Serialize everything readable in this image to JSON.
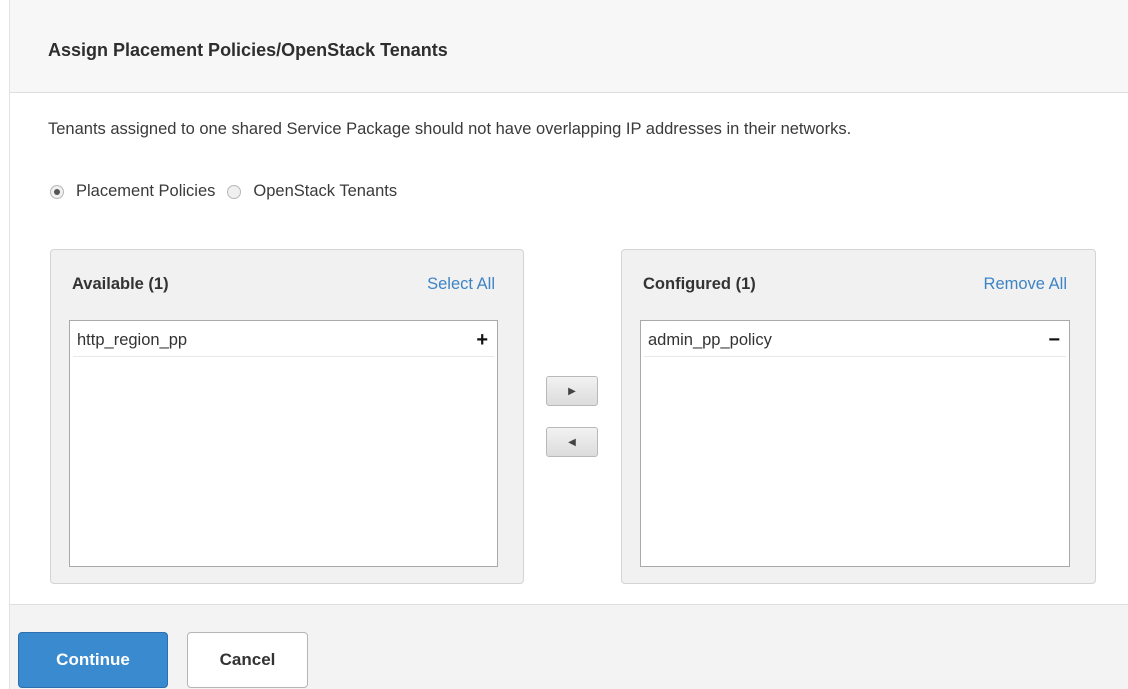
{
  "dialog": {
    "title": "Assign Placement Policies/OpenStack Tenants",
    "notice": "Tenants assigned to one shared Service Package should not have overlapping IP addresses in their networks."
  },
  "mode": {
    "options": [
      {
        "label": "Placement Policies",
        "selected": true
      },
      {
        "label": "OpenStack Tenants",
        "selected": false
      }
    ]
  },
  "available": {
    "title": "Available (1)",
    "action_link": "Select All",
    "items": [
      {
        "label": "http_region_pp",
        "action": "+"
      }
    ]
  },
  "configured": {
    "title": "Configured (1)",
    "action_link": "Remove All",
    "items": [
      {
        "label": "admin_pp_policy",
        "action": "−"
      }
    ]
  },
  "transfer": {
    "add_icon": "▶",
    "remove_icon": "◀"
  },
  "footer": {
    "continue_label": "Continue",
    "cancel_label": "Cancel"
  },
  "colors": {
    "accent": "#3a8ad0",
    "link": "#3e84c5"
  }
}
